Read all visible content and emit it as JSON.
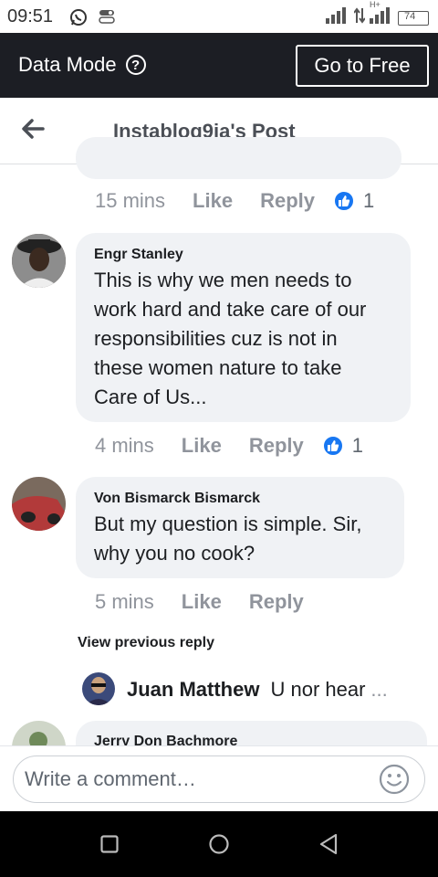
{
  "status_bar": {
    "time": "09:51",
    "battery": "74",
    "network": "H+"
  },
  "data_mode": {
    "label": "Data Mode",
    "go_free_label": "Go to Free"
  },
  "header": {
    "title": "Instablog9ja's Post"
  },
  "comments": [
    {
      "time": "15 mins",
      "like_label": "Like",
      "reply_label": "Reply",
      "reaction_count": "1"
    },
    {
      "author": "Engr Stanley",
      "lines": [
        "This is why we men needs to",
        "work hard and take care of our",
        "responsibilities cuz is not in",
        "these women nature to take",
        "Care of Us..."
      ],
      "time": "4 mins",
      "like_label": "Like",
      "reply_label": "Reply",
      "reaction_count": "1"
    },
    {
      "author": "Von Bismarck Bismarck",
      "lines": [
        "But my question is simple. Sir,",
        "why you no cook?"
      ],
      "time": "5 mins",
      "like_label": "Like",
      "reply_label": "Reply"
    }
  ],
  "view_previous": "View previous reply",
  "reply_preview": {
    "author": "Juan Matthew",
    "text": "U nor hear",
    "ellipsis": "..."
  },
  "partial_comment": {
    "author": "Jerry Don Bachmore"
  },
  "composer": {
    "placeholder": "Write a comment…"
  },
  "colors": {
    "accent": "#1877f2",
    "dark_bar": "#1c1e24",
    "bubble": "#f0f2f5",
    "meta": "#90949c"
  }
}
